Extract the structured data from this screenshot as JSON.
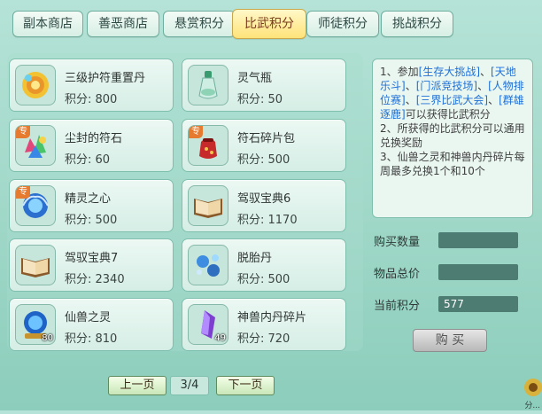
{
  "tabs": [
    {
      "label": "副本商店",
      "active": false
    },
    {
      "label": "善恶商店",
      "active": false
    },
    {
      "label": "悬赏积分",
      "active": false
    },
    {
      "label": "比武积分",
      "active": true
    },
    {
      "label": "师徒积分",
      "active": false
    },
    {
      "label": "挑战积分",
      "active": false
    }
  ],
  "items": [
    {
      "name": "三级护符重置丹",
      "points": "积分: 800",
      "icon": "gold-pill-icon",
      "tag": "",
      "count": ""
    },
    {
      "name": "灵气瓶",
      "points": "积分: 50",
      "icon": "bottle-icon",
      "tag": "",
      "count": ""
    },
    {
      "name": "尘封的符石",
      "points": "积分: 60",
      "icon": "gem-cluster-icon",
      "tag": "专",
      "count": ""
    },
    {
      "name": "符石碎片包",
      "points": "积分: 500",
      "icon": "pouch-icon",
      "tag": "专",
      "count": ""
    },
    {
      "name": "精灵之心",
      "points": "积分: 500",
      "icon": "spirit-heart-icon",
      "tag": "专",
      "count": ""
    },
    {
      "name": "驾驭宝典6",
      "points": "积分: 1170",
      "icon": "book-icon",
      "tag": "",
      "count": ""
    },
    {
      "name": "驾驭宝典7",
      "points": "积分: 2340",
      "icon": "book-icon",
      "tag": "",
      "count": ""
    },
    {
      "name": "脱胎丹",
      "points": "积分: 500",
      "icon": "pill-icon",
      "tag": "",
      "count": ""
    },
    {
      "name": "仙兽之灵",
      "points": "积分: 810",
      "icon": "blue-orb-icon",
      "tag": "",
      "count": "80"
    },
    {
      "name": "神兽内丹碎片",
      "points": "积分: 720",
      "icon": "purple-crystal-icon",
      "tag": "",
      "count": "49"
    }
  ],
  "description": {
    "line1_prefix": "1、参加",
    "link1": "[生存大挑战]",
    "sep1": "、",
    "link2": "[天地乐斗]",
    "sep2": "、",
    "link3": "[门派竞技场]",
    "sep3": "、",
    "link4": "[人物排位赛]",
    "sep4": "、",
    "link5": "[三界比武大会]",
    "sep5": "、",
    "link6": "[群雄逐鹿]",
    "line1_suffix": "可以获得比武积分",
    "line2": "2、所获得的比武积分可以通用兑换奖励",
    "line3": "3、仙兽之灵和神兽内丹碎片每周最多兑换1个和10个"
  },
  "form": {
    "qty_label": "购买数量",
    "qty_value": "",
    "total_label": "物品总价",
    "total_value": "",
    "current_label": "当前积分",
    "current_value": "577",
    "buy_button": "购 买"
  },
  "pager": {
    "prev": "上一页",
    "page": "3/4",
    "next": "下一页"
  },
  "corner_text": "分...",
  "colors": {
    "active_tab": "#ffe37a",
    "link": "#1d6fd6",
    "field_bg": "#4d7c73",
    "tag_bg": "#e67a2e"
  }
}
